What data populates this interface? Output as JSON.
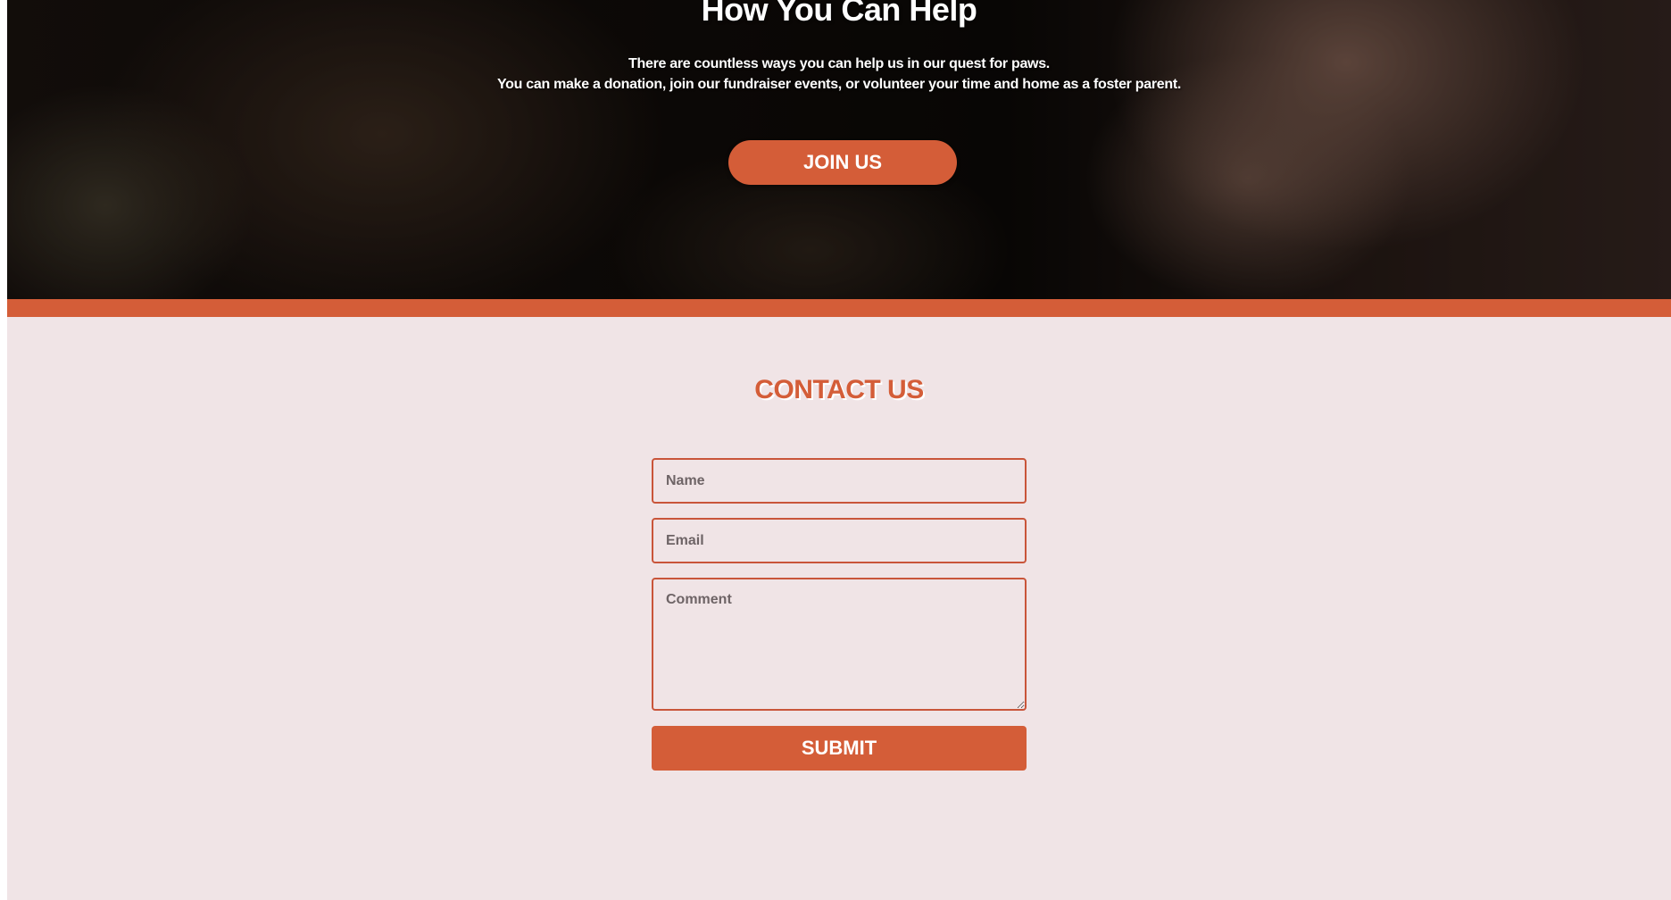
{
  "hero": {
    "title": "How You Can Help",
    "text_line_1": "There are countless ways you can help us in our quest for paws.",
    "text_line_2": "You can make a donation, join our fundraiser events, or volunteer your time and home as a foster parent.",
    "join_label": "JOIN US"
  },
  "contact": {
    "title": "CONTACT US",
    "name_placeholder": "Name",
    "email_placeholder": "Email",
    "comment_placeholder": "Comment",
    "submit_label": "SUBMIT"
  },
  "colors": {
    "accent": "#d45d38",
    "background": "#f0e4e6"
  }
}
